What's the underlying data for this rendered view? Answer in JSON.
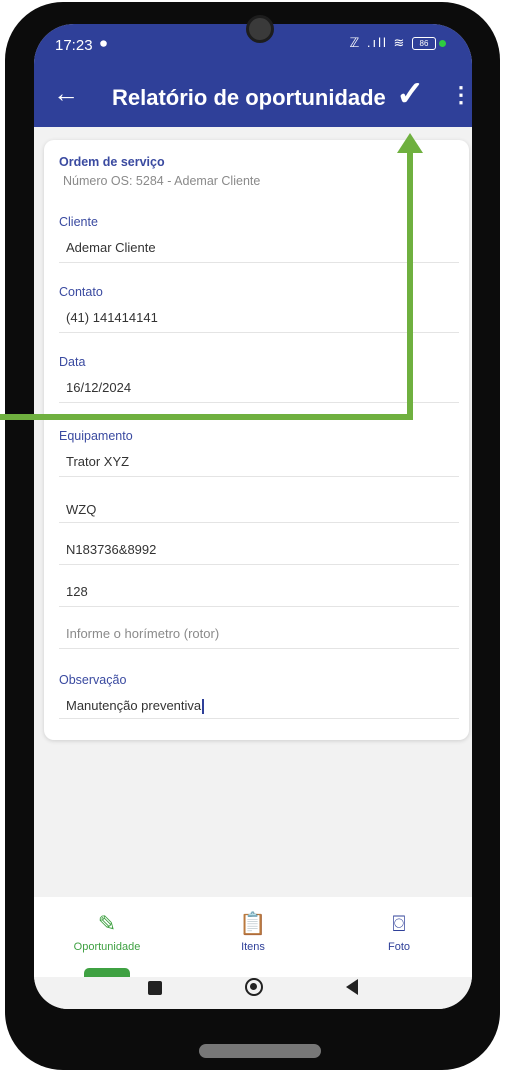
{
  "status": {
    "time": "17:23",
    "battery": "86",
    "signal_text": "ℤ .ıll ≋"
  },
  "toolbar": {
    "title": "Relatório de oportunidade"
  },
  "form": {
    "ordem_label": "Ordem de serviço",
    "ordem_value": "Número OS: 5284 - Ademar Cliente",
    "cliente_label": "Cliente",
    "cliente_value": "Ademar Cliente",
    "contato_label": "Contato",
    "contato_value": "(41) 141414141",
    "data_label": "Data",
    "data_value": "16/12/2024",
    "equipamento_label": "Equipamento",
    "equip_1": "Trator XYZ",
    "equip_2": "WZQ",
    "equip_3": "N183736&8992",
    "equip_4": "128",
    "horimetro_placeholder": "Informe o horímetro (rotor)",
    "observacao_label": "Observação",
    "observacao_value": "Manutenção preventiva"
  },
  "tabs": [
    {
      "label": "Oportunidade",
      "icon": "edit-icon",
      "active": true
    },
    {
      "label": "Itens",
      "icon": "clipboard-icon",
      "active": false
    },
    {
      "label": "Foto",
      "icon": "camera-icon",
      "active": false
    }
  ],
  "colors": {
    "primary": "#2f4099",
    "accent": "#3fa142",
    "annotation": "#6fb03f"
  }
}
